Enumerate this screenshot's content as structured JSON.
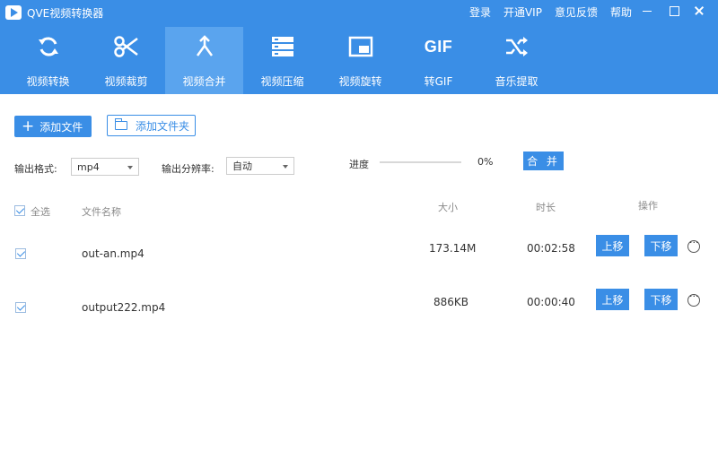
{
  "app": {
    "title": "QVE视频转换器"
  },
  "top_links": [
    "登录",
    "开通VIP",
    "意见反馈",
    "帮助"
  ],
  "nav": {
    "items": [
      {
        "label": "视频转换",
        "icon": "convert-icon"
      },
      {
        "label": "视频裁剪",
        "icon": "scissors-icon"
      },
      {
        "label": "视频合并",
        "icon": "merge-icon",
        "active": true
      },
      {
        "label": "视频压缩",
        "icon": "compress-icon"
      },
      {
        "label": "视频旋转",
        "icon": "rotate-icon"
      },
      {
        "label": "转GIF",
        "icon": "gif-icon",
        "icon_text": "GIF"
      },
      {
        "label": "音乐提取",
        "icon": "shuffle-icon"
      }
    ]
  },
  "toolbar": {
    "add_file": "添加文件",
    "add_folder": "添加文件夹",
    "output_format_label": "输出格式:",
    "output_format_value": "mp4",
    "resolution_label": "输出分辨率:",
    "resolution_value": "自动",
    "progress_label": "进度",
    "progress_percent": "0%",
    "progress_value": 0,
    "merge_button": "合 并"
  },
  "table": {
    "headers": {
      "select_all": "全选",
      "file_name": "文件名称",
      "size": "大小",
      "duration": "时长",
      "actions": "操作"
    },
    "rows": [
      {
        "checked": true,
        "name": "out-an.mp4",
        "size": "173.14M",
        "duration": "00:02:58",
        "move_up": "上移",
        "move_down": "下移"
      },
      {
        "checked": true,
        "name": "output222.mp4",
        "size": "886KB",
        "duration": "00:00:40",
        "move_up": "上移",
        "move_down": "下移"
      }
    ]
  },
  "colors": {
    "primary": "#3a8ee6",
    "nav_active": "#5aa4ee"
  }
}
